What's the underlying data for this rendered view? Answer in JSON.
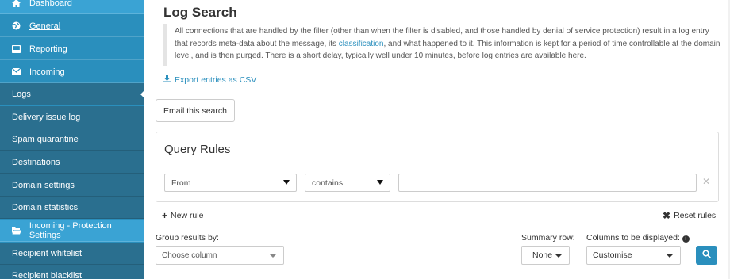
{
  "sidebar": {
    "items": [
      {
        "label": "Dashboard",
        "icon": "home-icon"
      },
      {
        "label": "General",
        "icon": "globe-icon"
      },
      {
        "label": "Reporting",
        "icon": "report-icon"
      },
      {
        "label": "Incoming",
        "icon": "envelope-icon"
      }
    ],
    "incoming_sub": [
      {
        "label": "Logs"
      },
      {
        "label": "Delivery issue log"
      },
      {
        "label": "Spam quarantine"
      },
      {
        "label": "Destinations"
      },
      {
        "label": "Domain settings"
      },
      {
        "label": "Domain statistics"
      }
    ],
    "protection": {
      "label": "Incoming - Protection Settings",
      "icon": "folder-icon"
    },
    "protection_sub": [
      {
        "label": "Recipient whitelist"
      },
      {
        "label": "Recipient blacklist"
      }
    ]
  },
  "page": {
    "title": "Log Search",
    "desc_part1": "All connections that are handled by the filter (other than when the filter is disabled, and those handled by denial of service protection) result in a log entry that records meta-data about the message, its ",
    "desc_link": "classification",
    "desc_part2": ", and what happened to it. This information is kept for a period of time controllable at the domain level, and is then purged. There is a short delay, typically well under 10 minutes, before log entries are available here.",
    "export_label": "Export entries as CSV",
    "email_button": "Email this search"
  },
  "query": {
    "title": "Query Rules",
    "field_value": "From",
    "operator_value": "contains",
    "input_value": "",
    "new_rule": "New rule",
    "reset_rules": "Reset rules"
  },
  "options": {
    "group_label": "Group results by:",
    "group_placeholder": "Choose column",
    "summary_label": "Summary row:",
    "summary_value": "None",
    "columns_label": "Columns to be displayed:",
    "columns_value": "Customise"
  },
  "colors": {
    "sidebar": "#2a8fbd",
    "sidebar_sub": "#2a6f8f",
    "accent": "#2a8fbd"
  }
}
